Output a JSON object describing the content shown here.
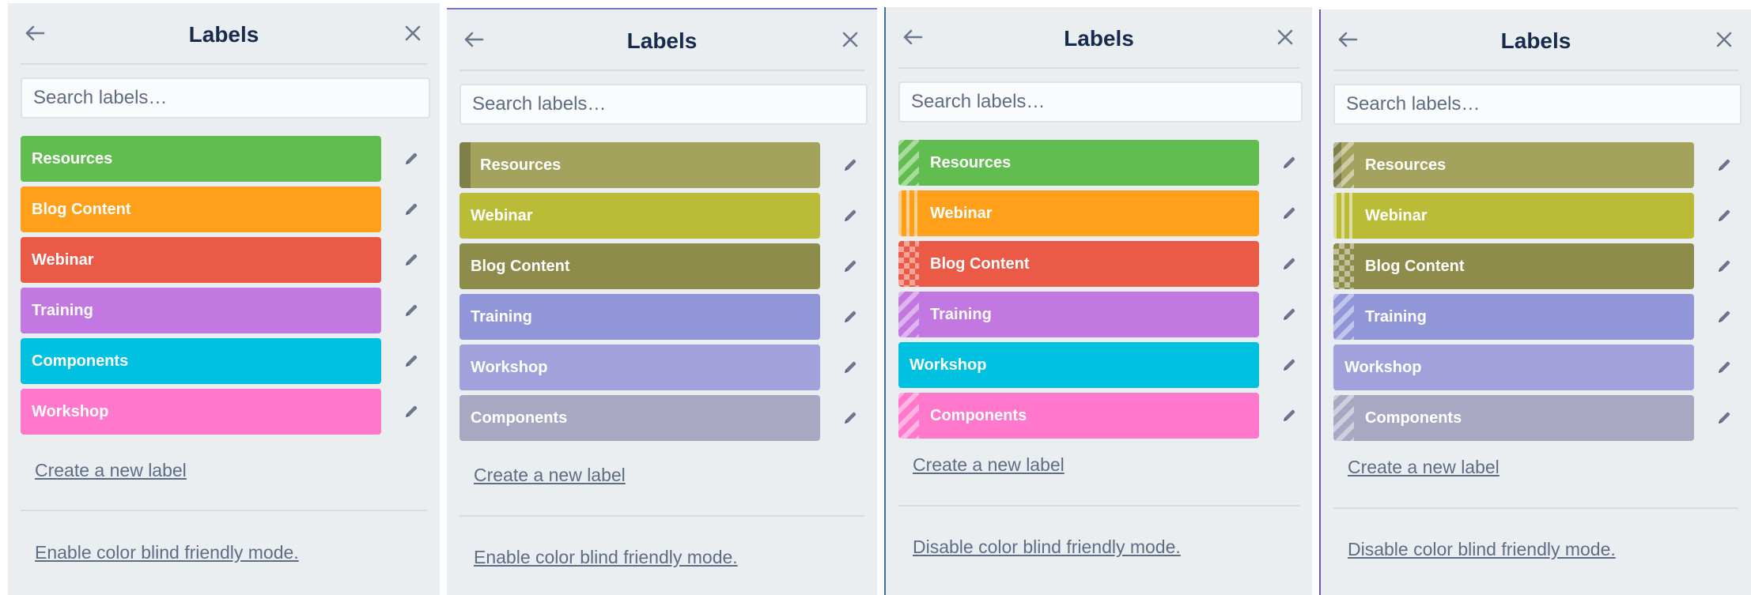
{
  "panels": [
    {
      "title": "Labels",
      "search_placeholder": "Search labels…",
      "labels": [
        {
          "name": "Resources",
          "color": "#61bd4f",
          "pattern": "none"
        },
        {
          "name": "Blog Content",
          "color": "#ff9f1a",
          "pattern": "none"
        },
        {
          "name": "Webinar",
          "color": "#eb5a46",
          "pattern": "none"
        },
        {
          "name": "Training",
          "color": "#c377e0",
          "pattern": "none"
        },
        {
          "name": "Components",
          "color": "#00c2e0",
          "pattern": "none"
        },
        {
          "name": "Workshop",
          "color": "#ff78cb",
          "pattern": "none"
        }
      ],
      "create_label": "Create a new label",
      "mode_toggle": "Enable color blind friendly mode."
    },
    {
      "title": "Labels",
      "search_placeholder": "Search labels…",
      "labels": [
        {
          "name": "Resources",
          "color": "#a4a35e",
          "pattern": "accent"
        },
        {
          "name": "Webinar",
          "color": "#babc37",
          "pattern": "none"
        },
        {
          "name": "Blog Content",
          "color": "#8e8c4a",
          "pattern": "none"
        },
        {
          "name": "Training",
          "color": "#9196d9",
          "pattern": "none"
        },
        {
          "name": "Workshop",
          "color": "#a2a1db",
          "pattern": "none"
        },
        {
          "name": "Components",
          "color": "#a8a8c3",
          "pattern": "none"
        }
      ],
      "create_label": "Create a new label",
      "mode_toggle": "Enable color blind friendly mode."
    },
    {
      "title": "Labels",
      "search_placeholder": "Search labels…",
      "labels": [
        {
          "name": "Resources",
          "color": "#61bd4f",
          "pattern": "diag"
        },
        {
          "name": "Webinar",
          "color": "#ff9f1a",
          "pattern": "vert"
        },
        {
          "name": "Blog Content",
          "color": "#eb5a46",
          "pattern": "check"
        },
        {
          "name": "Training",
          "color": "#c377e0",
          "pattern": "diag"
        },
        {
          "name": "Workshop",
          "color": "#00c2e0",
          "pattern": "none"
        },
        {
          "name": "Components",
          "color": "#ff78cb",
          "pattern": "diag"
        }
      ],
      "create_label": "Create a new label",
      "mode_toggle": "Disable color blind friendly mode."
    },
    {
      "title": "Labels",
      "search_placeholder": "Search labels…",
      "labels": [
        {
          "name": "Resources",
          "color": "#a4a35e",
          "pattern": "diag-accent"
        },
        {
          "name": "Webinar",
          "color": "#babc37",
          "pattern": "vert"
        },
        {
          "name": "Blog Content",
          "color": "#8e8c4a",
          "pattern": "check"
        },
        {
          "name": "Training",
          "color": "#9196d9",
          "pattern": "diag"
        },
        {
          "name": "Workshop",
          "color": "#a2a1db",
          "pattern": "none"
        },
        {
          "name": "Components",
          "color": "#a8a8c3",
          "pattern": "diag"
        }
      ],
      "create_label": "Create a new label",
      "mode_toggle": "Disable color blind friendly mode."
    }
  ],
  "icons": {
    "back": "arrow-left-icon",
    "close": "close-icon",
    "edit": "pencil-icon"
  }
}
